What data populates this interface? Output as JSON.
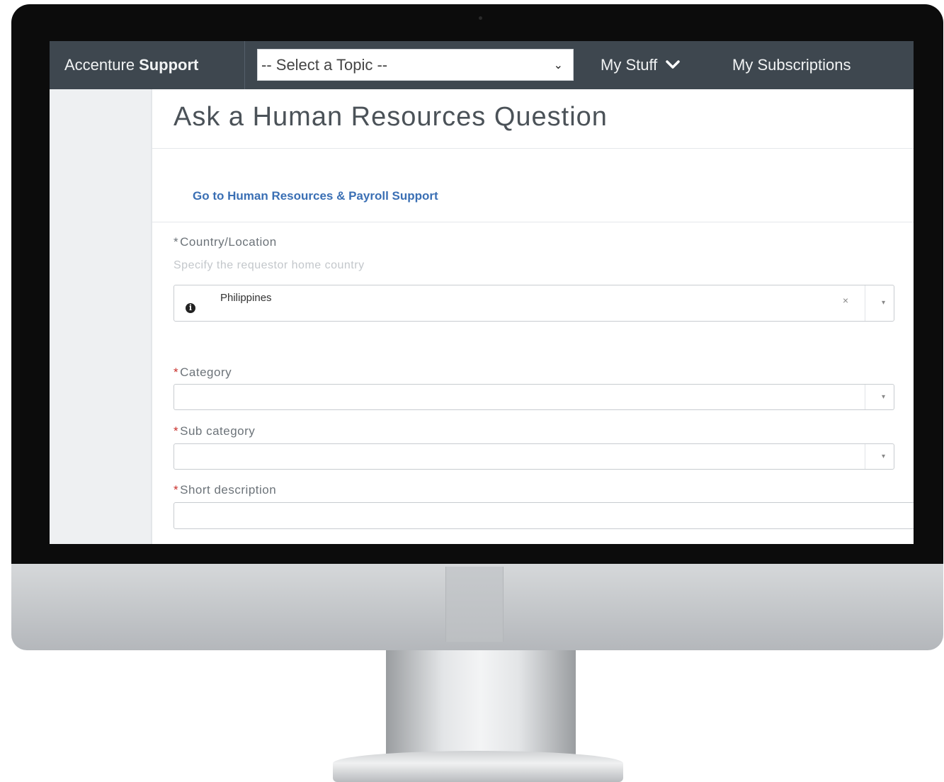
{
  "header": {
    "brand_prefix": "Accenture",
    "brand_bold": "Support",
    "topic_select": {
      "value": "-- Select a Topic --"
    },
    "nav": [
      {
        "label": "My Stuff"
      },
      {
        "label": "My Subscriptions"
      }
    ]
  },
  "page": {
    "title": "Ask a Human Resources Question",
    "link": "Go to Human Resources & Payroll Support"
  },
  "form": {
    "country": {
      "label": "Country/Location",
      "required_mark": "*",
      "help": "Specify the requestor home country",
      "value": "Philippines",
      "clear_glyph": "×"
    },
    "category": {
      "label": "Category",
      "required_mark": "*",
      "value": ""
    },
    "subcategory": {
      "label": "Sub category",
      "required_mark": "*",
      "value": ""
    },
    "short_description": {
      "label": "Short description",
      "required_mark": "*",
      "value": ""
    }
  },
  "icons": {
    "info": "i",
    "dropdown_chevron": "⌄",
    "combo_arrow": "▾"
  },
  "colors": {
    "nav_bg": "#3e474f",
    "link": "#3a6fb4",
    "required": "#c9302c"
  }
}
